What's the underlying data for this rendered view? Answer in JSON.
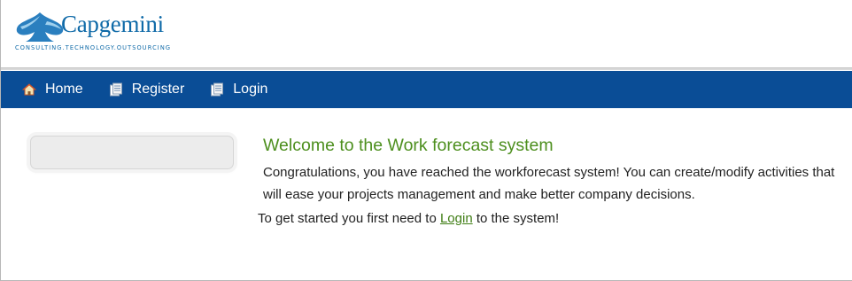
{
  "logo": {
    "brand_name": "Capgemini",
    "tagline": "CONSULTING.TECHNOLOGY.OUTSOURCING",
    "brand_color": "#0f6aa8"
  },
  "nav": {
    "background_color": "#0a4d96",
    "items": [
      {
        "label": "Home",
        "icon": "home-icon"
      },
      {
        "label": "Register",
        "icon": "document-icon"
      },
      {
        "label": "Login",
        "icon": "document-icon"
      }
    ]
  },
  "main": {
    "title": "Welcome to the Work forecast system",
    "title_color": "#4d8f1e",
    "intro": "Congratulations, you have reached the workforecast system! You can create/modify activities that will ease your projects management and make better company decisions.",
    "start_prefix": "To get started you first need to ",
    "start_link": "Login",
    "start_suffix": " to the system!"
  }
}
